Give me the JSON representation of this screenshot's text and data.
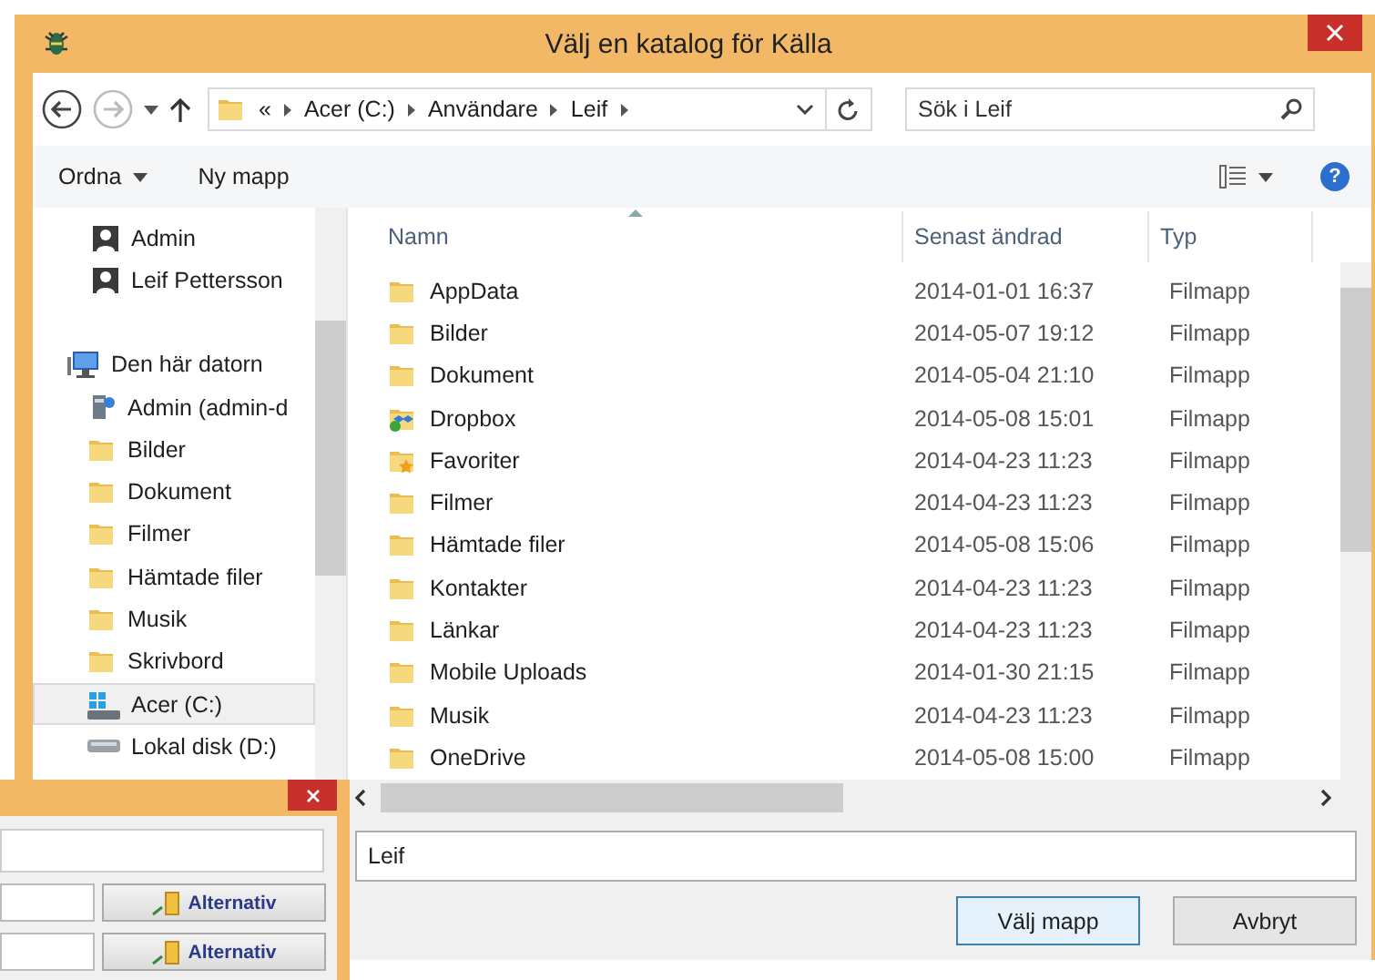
{
  "dialog": {
    "title": "Välj en katalog för Källa",
    "address_bar": {
      "path": [
        "«",
        "Acer (C:)",
        "Användare",
        "Leif"
      ]
    },
    "search": {
      "placeholder": "Sök i Leif"
    },
    "toolbar": {
      "buttons": [
        "Ordna",
        "Ny mapp"
      ],
      "help": "?"
    },
    "sidebar": {
      "items": [
        {
          "label": "Admin",
          "kind": "user",
          "selected": false
        },
        {
          "label": "Leif Pettersson",
          "kind": "user",
          "selected": false
        },
        {
          "label": "Den här datorn",
          "kind": "computer",
          "selected": false,
          "children": [
            {
              "label": "Admin (admin-d",
              "kind": "network",
              "selected": false
            },
            {
              "label": "Bilder",
              "kind": "folder",
              "selected": false
            },
            {
              "label": "Dokument",
              "kind": "folder",
              "selected": false
            },
            {
              "label": "Filmer",
              "kind": "folder",
              "selected": false
            },
            {
              "label": "Hämtade filer",
              "kind": "folder",
              "selected": false
            },
            {
              "label": "Musik",
              "kind": "folder",
              "selected": false
            },
            {
              "label": "Skrivbord",
              "kind": "folder",
              "selected": false
            },
            {
              "label": "Acer (C:)",
              "kind": "system-drive",
              "selected": true
            },
            {
              "label": "Lokal disk (D:)",
              "kind": "drive",
              "selected": false
            }
          ]
        }
      ]
    },
    "table": {
      "columns": [
        "Namn",
        "Senast ändrad",
        "Typ"
      ],
      "rows": [
        {
          "name": "AppData",
          "modified": "2014-01-01 16:37",
          "type": "Filmapp",
          "kind": "folder"
        },
        {
          "name": "Bilder",
          "modified": "2014-05-07 19:12",
          "type": "Filmapp",
          "kind": "folder"
        },
        {
          "name": "Dokument",
          "modified": "2014-05-04 21:10",
          "type": "Filmapp",
          "kind": "folder"
        },
        {
          "name": "Dropbox",
          "modified": "2014-05-08 15:01",
          "type": "Filmapp",
          "kind": "dropbox"
        },
        {
          "name": "Favoriter",
          "modified": "2014-04-23 11:23",
          "type": "Filmapp",
          "kind": "star-folder"
        },
        {
          "name": "Filmer",
          "modified": "2014-04-23 11:23",
          "type": "Filmapp",
          "kind": "folder"
        },
        {
          "name": "Hämtade filer",
          "modified": "2014-05-08 15:06",
          "type": "Filmapp",
          "kind": "folder"
        },
        {
          "name": "Kontakter",
          "modified": "2014-04-23 11:23",
          "type": "Filmapp",
          "kind": "folder"
        },
        {
          "name": "Länkar",
          "modified": "2014-04-23 11:23",
          "type": "Filmapp",
          "kind": "folder"
        },
        {
          "name": "Mobile Uploads",
          "modified": "2014-01-30 21:15",
          "type": "Filmapp",
          "kind": "folder"
        },
        {
          "name": "Musik",
          "modified": "2014-04-23 11:23",
          "type": "Filmapp",
          "kind": "folder"
        },
        {
          "name": "OneDrive",
          "modified": "2014-05-08 15:00",
          "type": "Filmapp",
          "kind": "folder"
        }
      ]
    },
    "folder_field": {
      "value": "Leif"
    },
    "buttons": [
      {
        "label": "Välj mapp",
        "default": true
      },
      {
        "label": "Avbryt",
        "default": false
      }
    ]
  },
  "background_window": {
    "buttons": [
      "Alternativ",
      "Alternativ"
    ]
  }
}
